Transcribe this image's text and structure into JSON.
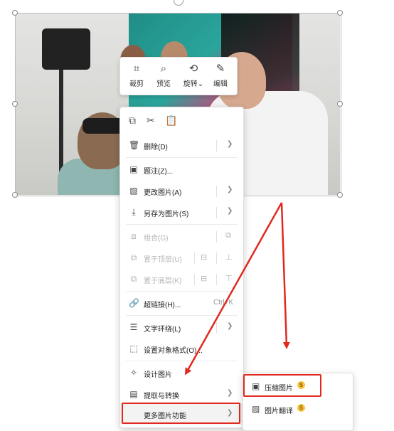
{
  "toolbar": {
    "crop": "裁剪",
    "preview": "预览",
    "rotate": "旋转",
    "rotate_chevron": "⌄",
    "edit": "编辑"
  },
  "context_menu": {
    "delete": "删除(D)",
    "caption": "题注(Z)...",
    "change_picture": "更改图片(A)",
    "save_as_picture": "另存为图片(S)",
    "group": "组合(G)",
    "bring_to_front": "置于顶层(U)",
    "send_to_back": "置于底层(K)",
    "hyperlink": "超链接(H)...",
    "hyperlink_shortcut": "Ctrl+K",
    "text_wrap": "文字环绕(L)",
    "format_object": "设置对象格式(O)...",
    "design_picture": "设计图片",
    "extract_convert": "提取与转换",
    "more_picture_functions": "更多图片功能"
  },
  "submenu": {
    "compress_picture": "压缩图片",
    "translate_picture": "图片翻译"
  },
  "colors": {
    "highlight_red": "#e0291f",
    "coin": "#f7c744"
  }
}
